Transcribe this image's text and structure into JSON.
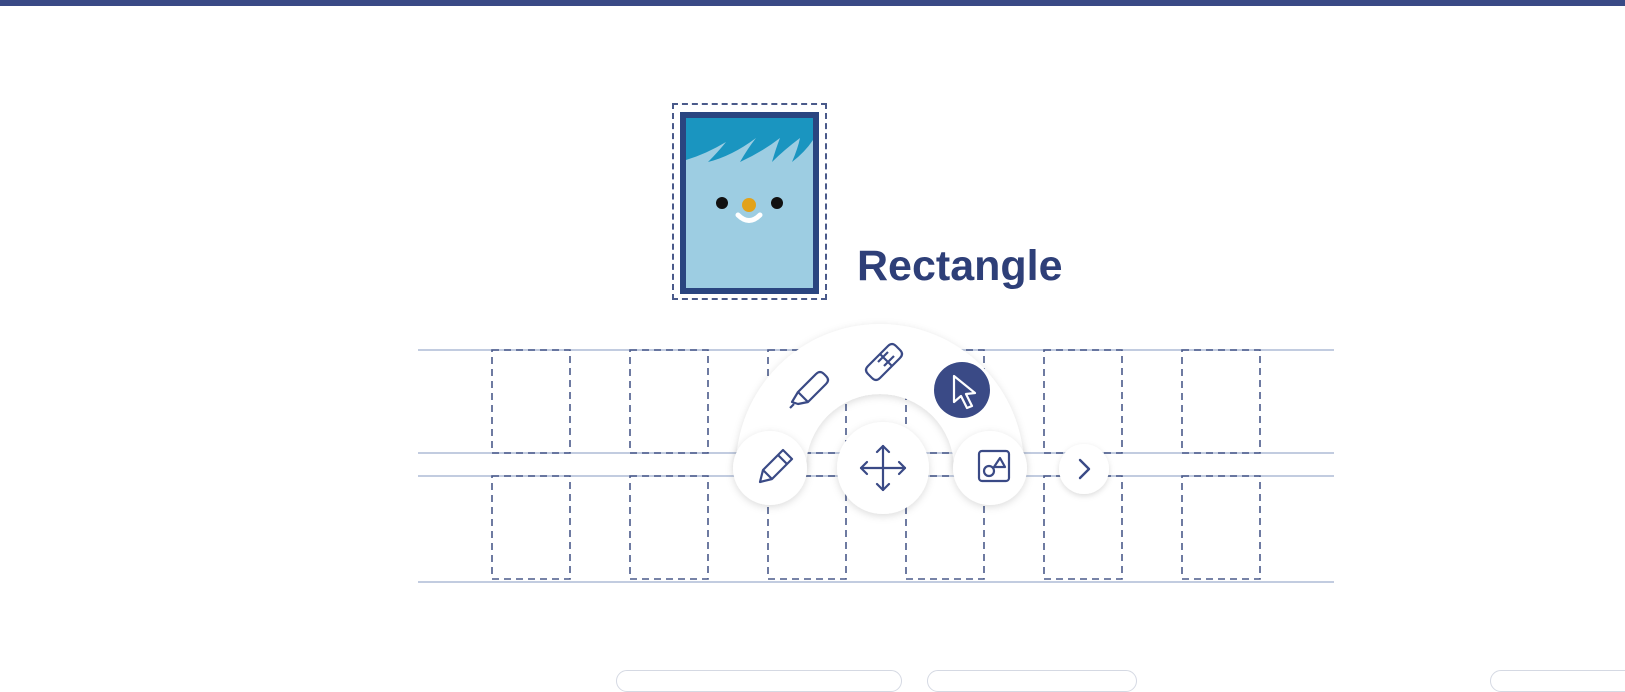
{
  "colors": {
    "primary": "#3a4a86",
    "title": "#2e3f78",
    "mascot_body": "#9dcde2",
    "mascot_hair": "#1a95c0",
    "mascot_border": "#2a4580",
    "nose": "#e2a21a",
    "guide_line": "#c2cce0",
    "dash": "#4a5a8a"
  },
  "shape": {
    "name": "Rectangle",
    "mascot_icon": "rectangle-mascot-icon"
  },
  "toolbar": {
    "tools": [
      {
        "id": "pencil",
        "icon": "pencil-icon",
        "active": false
      },
      {
        "id": "highlighter",
        "icon": "highlighter-icon",
        "active": false
      },
      {
        "id": "eraser",
        "icon": "eraser-icon",
        "active": false
      },
      {
        "id": "select",
        "icon": "cursor-icon",
        "active": true
      },
      {
        "id": "shapes",
        "icon": "shapes-icon",
        "active": false
      }
    ],
    "center_tool": {
      "id": "move",
      "icon": "move-icon"
    },
    "expand": {
      "id": "expand",
      "icon": "chevron-right-icon"
    }
  },
  "practice": {
    "rows": 2,
    "boxes_per_row": 6
  }
}
